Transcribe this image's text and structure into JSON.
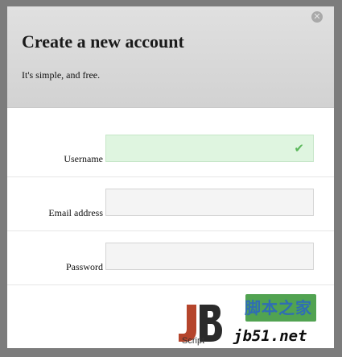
{
  "modal": {
    "title": "Create a new account",
    "subtitle": "It's simple, and free.",
    "close_icon": "close-icon",
    "close_glyph": "✕"
  },
  "form": {
    "fields": [
      {
        "label": "Username",
        "value": "",
        "state": "valid",
        "status_icon": "check-icon",
        "status_glyph": "✔"
      },
      {
        "label": "Email address",
        "value": "",
        "state": "empty"
      },
      {
        "label": "Password",
        "value": "",
        "state": "empty"
      }
    ],
    "submit_label": ""
  },
  "watermark": {
    "logo_text": "Script",
    "chinese_text": "脚本之家",
    "url_text": "jb51.net"
  },
  "colors": {
    "backdrop": "#7c7c7c",
    "header": "#d8d8d8",
    "valid_fill": "#dff5e0",
    "valid_check": "#5cb85c",
    "submit": "#51a351",
    "watermark_blue": "#2f6db5",
    "watermark_logo": "#b5452c"
  }
}
